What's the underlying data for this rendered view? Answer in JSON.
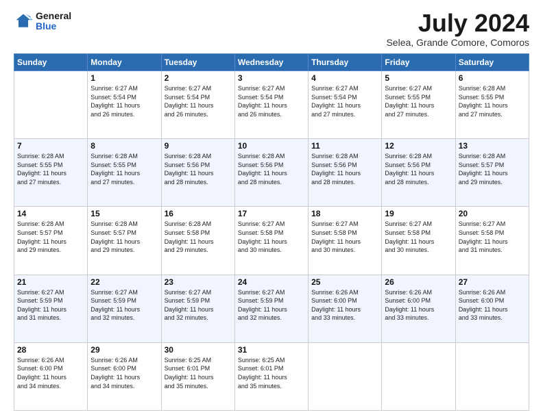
{
  "logo": {
    "general": "General",
    "blue": "Blue"
  },
  "title": "July 2024",
  "subtitle": "Selea, Grande Comore, Comoros",
  "days_of_week": [
    "Sunday",
    "Monday",
    "Tuesday",
    "Wednesday",
    "Thursday",
    "Friday",
    "Saturday"
  ],
  "weeks": [
    [
      {
        "day": "",
        "info": ""
      },
      {
        "day": "1",
        "info": "Sunrise: 6:27 AM\nSunset: 5:54 PM\nDaylight: 11 hours\nand 26 minutes."
      },
      {
        "day": "2",
        "info": "Sunrise: 6:27 AM\nSunset: 5:54 PM\nDaylight: 11 hours\nand 26 minutes."
      },
      {
        "day": "3",
        "info": "Sunrise: 6:27 AM\nSunset: 5:54 PM\nDaylight: 11 hours\nand 26 minutes."
      },
      {
        "day": "4",
        "info": "Sunrise: 6:27 AM\nSunset: 5:54 PM\nDaylight: 11 hours\nand 27 minutes."
      },
      {
        "day": "5",
        "info": "Sunrise: 6:27 AM\nSunset: 5:55 PM\nDaylight: 11 hours\nand 27 minutes."
      },
      {
        "day": "6",
        "info": "Sunrise: 6:28 AM\nSunset: 5:55 PM\nDaylight: 11 hours\nand 27 minutes."
      }
    ],
    [
      {
        "day": "7",
        "info": "Sunrise: 6:28 AM\nSunset: 5:55 PM\nDaylight: 11 hours\nand 27 minutes."
      },
      {
        "day": "8",
        "info": "Sunrise: 6:28 AM\nSunset: 5:55 PM\nDaylight: 11 hours\nand 27 minutes."
      },
      {
        "day": "9",
        "info": "Sunrise: 6:28 AM\nSunset: 5:56 PM\nDaylight: 11 hours\nand 28 minutes."
      },
      {
        "day": "10",
        "info": "Sunrise: 6:28 AM\nSunset: 5:56 PM\nDaylight: 11 hours\nand 28 minutes."
      },
      {
        "day": "11",
        "info": "Sunrise: 6:28 AM\nSunset: 5:56 PM\nDaylight: 11 hours\nand 28 minutes."
      },
      {
        "day": "12",
        "info": "Sunrise: 6:28 AM\nSunset: 5:56 PM\nDaylight: 11 hours\nand 28 minutes."
      },
      {
        "day": "13",
        "info": "Sunrise: 6:28 AM\nSunset: 5:57 PM\nDaylight: 11 hours\nand 29 minutes."
      }
    ],
    [
      {
        "day": "14",
        "info": "Sunrise: 6:28 AM\nSunset: 5:57 PM\nDaylight: 11 hours\nand 29 minutes."
      },
      {
        "day": "15",
        "info": "Sunrise: 6:28 AM\nSunset: 5:57 PM\nDaylight: 11 hours\nand 29 minutes."
      },
      {
        "day": "16",
        "info": "Sunrise: 6:28 AM\nSunset: 5:58 PM\nDaylight: 11 hours\nand 29 minutes."
      },
      {
        "day": "17",
        "info": "Sunrise: 6:27 AM\nSunset: 5:58 PM\nDaylight: 11 hours\nand 30 minutes."
      },
      {
        "day": "18",
        "info": "Sunrise: 6:27 AM\nSunset: 5:58 PM\nDaylight: 11 hours\nand 30 minutes."
      },
      {
        "day": "19",
        "info": "Sunrise: 6:27 AM\nSunset: 5:58 PM\nDaylight: 11 hours\nand 30 minutes."
      },
      {
        "day": "20",
        "info": "Sunrise: 6:27 AM\nSunset: 5:58 PM\nDaylight: 11 hours\nand 31 minutes."
      }
    ],
    [
      {
        "day": "21",
        "info": "Sunrise: 6:27 AM\nSunset: 5:59 PM\nDaylight: 11 hours\nand 31 minutes."
      },
      {
        "day": "22",
        "info": "Sunrise: 6:27 AM\nSunset: 5:59 PM\nDaylight: 11 hours\nand 32 minutes."
      },
      {
        "day": "23",
        "info": "Sunrise: 6:27 AM\nSunset: 5:59 PM\nDaylight: 11 hours\nand 32 minutes."
      },
      {
        "day": "24",
        "info": "Sunrise: 6:27 AM\nSunset: 5:59 PM\nDaylight: 11 hours\nand 32 minutes."
      },
      {
        "day": "25",
        "info": "Sunrise: 6:26 AM\nSunset: 6:00 PM\nDaylight: 11 hours\nand 33 minutes."
      },
      {
        "day": "26",
        "info": "Sunrise: 6:26 AM\nSunset: 6:00 PM\nDaylight: 11 hours\nand 33 minutes."
      },
      {
        "day": "27",
        "info": "Sunrise: 6:26 AM\nSunset: 6:00 PM\nDaylight: 11 hours\nand 33 minutes."
      }
    ],
    [
      {
        "day": "28",
        "info": "Sunrise: 6:26 AM\nSunset: 6:00 PM\nDaylight: 11 hours\nand 34 minutes."
      },
      {
        "day": "29",
        "info": "Sunrise: 6:26 AM\nSunset: 6:00 PM\nDaylight: 11 hours\nand 34 minutes."
      },
      {
        "day": "30",
        "info": "Sunrise: 6:25 AM\nSunset: 6:01 PM\nDaylight: 11 hours\nand 35 minutes."
      },
      {
        "day": "31",
        "info": "Sunrise: 6:25 AM\nSunset: 6:01 PM\nDaylight: 11 hours\nand 35 minutes."
      },
      {
        "day": "",
        "info": ""
      },
      {
        "day": "",
        "info": ""
      },
      {
        "day": "",
        "info": ""
      }
    ]
  ]
}
